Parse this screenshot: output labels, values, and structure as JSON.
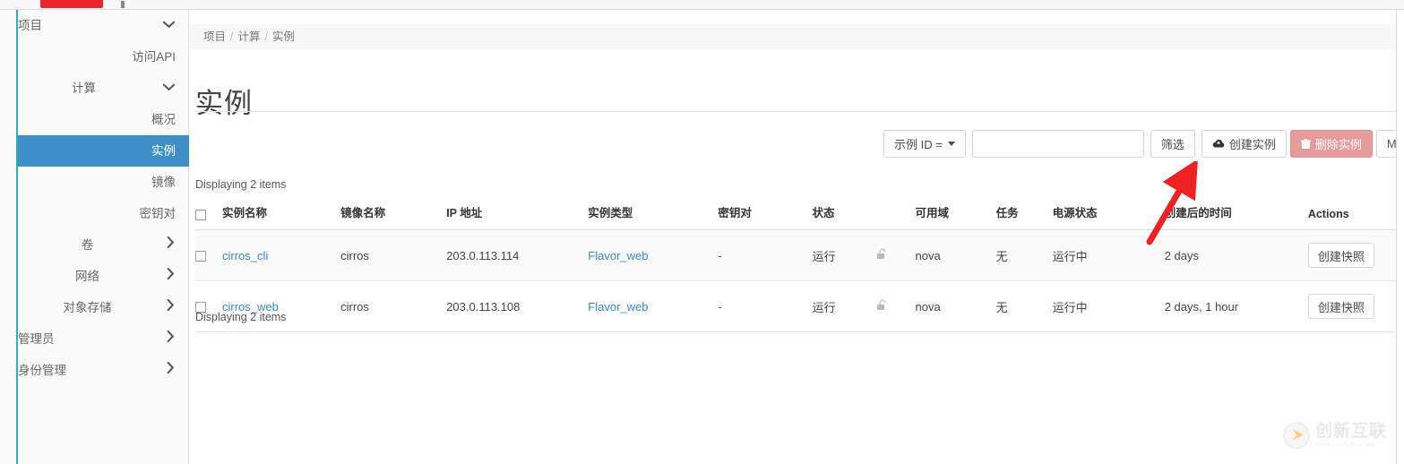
{
  "brand": {
    "accent_red": "#e8252a",
    "sidebar_accent": "#3aaabf",
    "active_blue": "#3e8fc8",
    "danger": "#e79c9c",
    "link_blue": "#3a87c8"
  },
  "sidebar": {
    "items": [
      {
        "label": "项目",
        "level": "top",
        "icon": "chevron-down-icon",
        "active": false
      },
      {
        "label": "访问API",
        "level": "leaf",
        "icon": "",
        "active": false
      },
      {
        "label": "计算",
        "level": "2",
        "icon": "chevron-down-icon",
        "active": false
      },
      {
        "label": "概况",
        "level": "leaf",
        "icon": "",
        "active": false
      },
      {
        "label": "实例",
        "level": "leaf",
        "icon": "",
        "active": true
      },
      {
        "label": "镜像",
        "level": "leaf",
        "icon": "",
        "active": false
      },
      {
        "label": "密钥对",
        "level": "leaf",
        "icon": "",
        "active": false
      },
      {
        "label": "卷",
        "level": "grp",
        "icon": "chevron-right-icon",
        "active": false
      },
      {
        "label": "网络",
        "level": "grp",
        "icon": "chevron-right-icon",
        "active": false
      },
      {
        "label": "对象存储",
        "level": "grp",
        "icon": "chevron-right-icon",
        "active": false
      },
      {
        "label": "管理员",
        "level": "top",
        "icon": "chevron-right-icon",
        "active": false
      },
      {
        "label": "身份管理",
        "level": "top",
        "icon": "chevron-right-icon",
        "active": false
      }
    ]
  },
  "breadcrumb": {
    "items": [
      "项目",
      "计算",
      "实例"
    ],
    "separator": "/"
  },
  "page": {
    "title": "实例"
  },
  "toolbar": {
    "filter_select_label": "示例 ID =",
    "search_value": "",
    "search_placeholder": "",
    "filter_button": "筛选",
    "create_button": "创建实例",
    "delete_button": "删除实例",
    "more_button": "More Actio"
  },
  "table": {
    "count_top": "Displaying 2 items",
    "count_bottom": "Displaying 2 items",
    "headers": [
      "",
      "实例名称",
      "镜像名称",
      "IP 地址",
      "实例类型",
      "密钥对",
      "状态",
      "",
      "可用域",
      "任务",
      "电源状态",
      "创建后的时间",
      "Actions"
    ],
    "rows": [
      {
        "name": "cirros_cli",
        "image": "cirros",
        "ip": "203.0.113.114",
        "flavor": "Flavor_web",
        "keypair": "-",
        "status": "运行",
        "lock": "unlock-icon",
        "az": "nova",
        "task": "无",
        "power": "运行中",
        "uptime": "2 days",
        "action": "创建快照"
      },
      {
        "name": "cirros_web",
        "image": "cirros",
        "ip": "203.0.113.108",
        "flavor": "Flavor_web",
        "keypair": "-",
        "status": "运行",
        "lock": "unlock-icon",
        "az": "nova",
        "task": "无",
        "power": "运行中",
        "uptime": "2 days, 1 hour",
        "action": "创建快照"
      }
    ]
  },
  "annotation": {
    "type": "arrow",
    "color": "#ee2222",
    "points_to": "创建后的时间"
  },
  "watermark": {
    "text": "创新互联",
    "subtext": "CHUANGXIN HULIAN"
  }
}
